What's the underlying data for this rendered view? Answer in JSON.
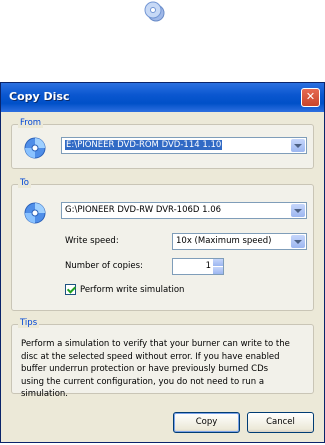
{
  "dialog": {
    "title": "Copy Disc",
    "close_glyph": "✕"
  },
  "from": {
    "label": "From",
    "drive": "E:\\PIONEER DVD-ROM DVD-114 1.10"
  },
  "to": {
    "label": "To",
    "drive": "G:\\PIONEER DVD-RW DVR-106D 1.06",
    "write_speed_label": "Write speed:",
    "write_speed_value": "10x (Maximum speed)",
    "copies_label": "Number of copies:",
    "copies_value": "1",
    "simulation_label": "Perform write simulation",
    "simulation_checked": true
  },
  "tips": {
    "label": "Tips",
    "text": "Perform a simulation to verify that your burner can write to the disc at the selected speed without error. If you have enabled buffer underrun protection or have previously burned CDs using the current configuration, you do not need to run a simulation."
  },
  "buttons": {
    "copy": "Copy",
    "cancel": "Cancel"
  },
  "icons": {
    "top": "cd-stack-icon",
    "drive": "cd-disc-icon"
  }
}
